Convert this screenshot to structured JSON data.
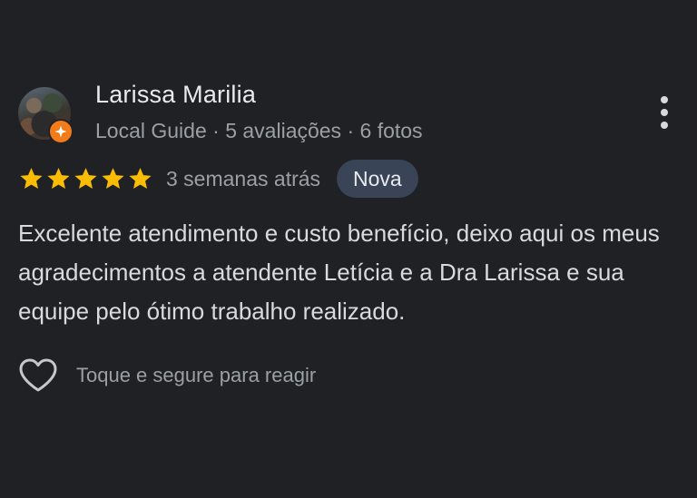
{
  "reviewer": {
    "name": "Larissa Marilia",
    "level": "Local Guide",
    "separator": " · ",
    "reviews": "5 avaliações",
    "photos": "6 fotos"
  },
  "review": {
    "rating": 5,
    "max_rating": 5,
    "time": "3 semanas atrás",
    "badge": "Nova",
    "text": "Excelente atendimento e custo benefício, deixo aqui os meus agradecimentos a atendente Letícia e a Dra Larissa e sua equipe pelo ótimo trabalho realizado."
  },
  "reaction": {
    "label": "Toque e segure para reagir"
  },
  "icons": {
    "more": "more-vert-icon",
    "star": "star-icon",
    "heart": "heart-outline-icon",
    "guide_badge": "local-guide-badge-icon"
  },
  "colors": {
    "background": "#202124",
    "star": "#fbbc04",
    "badge_bg": "#394457",
    "guide_badge": "#f27b1a",
    "primary_text": "#e8eaed",
    "secondary_text": "#9aa0a6"
  }
}
